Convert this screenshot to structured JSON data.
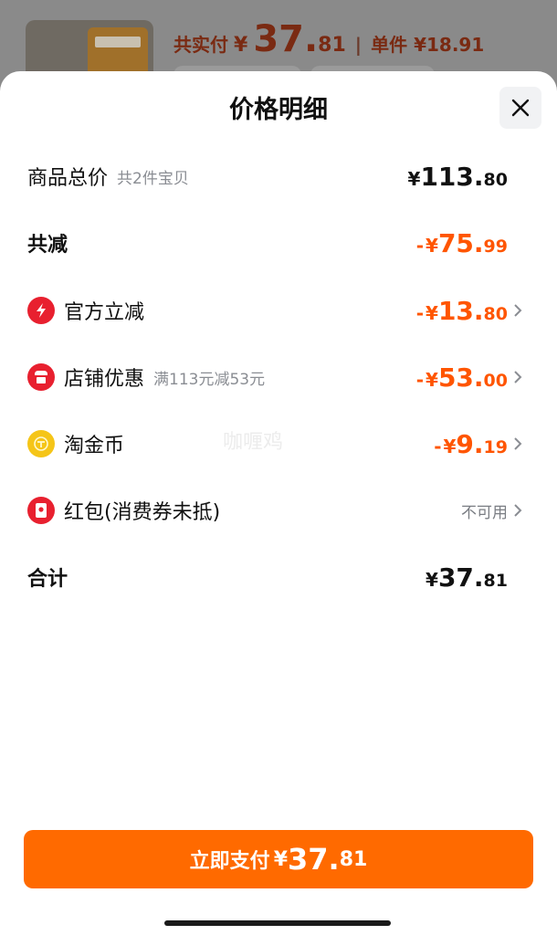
{
  "background": {
    "paid_label": "共实付",
    "currency": "¥",
    "paid_int": "37.",
    "paid_dec": "81",
    "separator": "|",
    "unit_price": "单件 ¥18.91"
  },
  "sheet": {
    "title": "价格明细",
    "close_icon": "close-icon"
  },
  "rows": {
    "total": {
      "label": "商品总价",
      "sub": "共2件宝贝",
      "yen": "¥",
      "int": "113.",
      "dec": "80"
    },
    "discount": {
      "label": "共减",
      "minus": "-",
      "yen": "¥",
      "int": "75.",
      "dec": "99"
    },
    "official": {
      "label": "官方立减",
      "minus": "-",
      "yen": "¥",
      "int": "13.",
      "dec": "80",
      "icon": "lightning-icon"
    },
    "shop": {
      "label": "店铺优惠",
      "sub": "满113元减53元",
      "minus": "-",
      "yen": "¥",
      "int": "53.",
      "dec": "00",
      "icon": "shop-icon"
    },
    "coins": {
      "label": "淘金币",
      "minus": "-",
      "yen": "¥",
      "int": "9.",
      "dec": "19",
      "icon": "coin-icon"
    },
    "redpacket": {
      "label": "红包(消费券未抵)",
      "status": "不可用",
      "icon": "red-packet-icon"
    },
    "sum": {
      "label": "合计",
      "yen": "¥",
      "int": "37.",
      "dec": "81"
    }
  },
  "watermark": "咖喱鸡",
  "pay_button": {
    "label": "立即支付",
    "yen": "¥",
    "int": "37.",
    "dec": "81"
  },
  "colors": {
    "accent": "#ff6a00",
    "discount": "#ff5500",
    "icon_red": "#e8202f",
    "coin": "#f5c518"
  }
}
